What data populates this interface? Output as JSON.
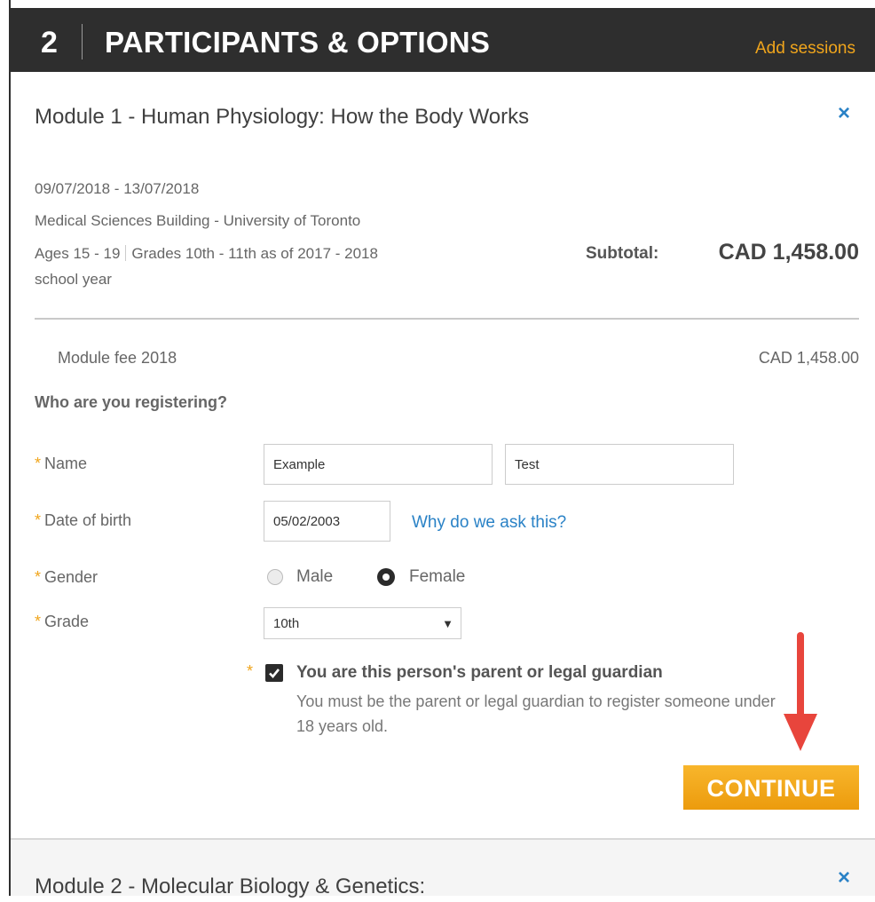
{
  "header": {
    "step_number": "2",
    "step_title": "PARTICIPANTS & OPTIONS",
    "add_sessions_link": "Add sessions"
  },
  "module1": {
    "title": "Module 1 - Human Physiology: How the Body Works",
    "dates": "09/07/2018 - 13/07/2018",
    "location": "Medical Sciences Building - University of Toronto",
    "ages": "Ages 15 - 19",
    "grades": "Grades 10th - 11th as of 2017 - 2018",
    "school_year": "school year",
    "subtotal_label": "Subtotal:",
    "subtotal_value": "CAD 1,458.00",
    "fee_label": "Module fee 2018",
    "fee_value": "CAD 1,458.00",
    "close_icon": "×"
  },
  "form": {
    "question": "Who are you registering?",
    "required_marker": "*",
    "name_label": "Name",
    "first_name_value": "Example",
    "last_name_value": "Test",
    "dob_label": "Date of birth",
    "dob_value": "05/02/2003",
    "why_link": "Why do we ask this?",
    "gender_label": "Gender",
    "gender_options": [
      "Male",
      "Female"
    ],
    "gender_selected": "Female",
    "grade_label": "Grade",
    "grade_value": "10th",
    "guardian_checked": true,
    "guardian_label": "You are this person's parent or legal guardian",
    "guardian_note": "You must be the parent or legal guardian to register someone under 18 years old.",
    "continue_button": "CONTINUE"
  },
  "module2": {
    "title": "Module 2 - Molecular Biology & Genetics:",
    "close_icon": "×"
  },
  "icons": {
    "close": "close-icon",
    "select_arrow": "chevron-down-icon",
    "checkbox": "checkmark-icon",
    "annotation_arrow": "arrow-down-icon"
  },
  "colors": {
    "header_bg": "#2e2e2e",
    "accent_orange": "#f0a51c",
    "link_blue": "#2a82c6",
    "annotation_red": "#e8453c"
  }
}
